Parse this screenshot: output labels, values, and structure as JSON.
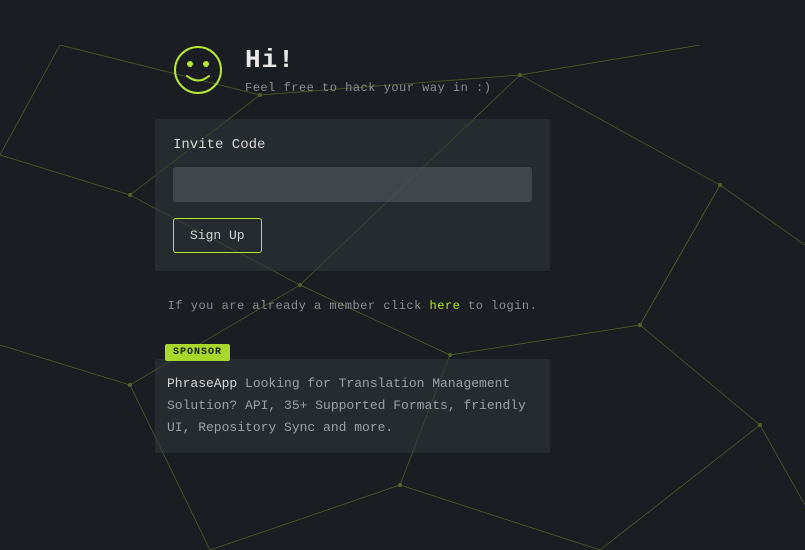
{
  "header": {
    "greeting": "Hi!",
    "subtitle": "Feel free to hack your way in :)"
  },
  "form": {
    "field_label": "Invite Code",
    "input_value": "",
    "input_placeholder": "",
    "submit_label": "Sign Up"
  },
  "login": {
    "prefix": "If you are already a member click ",
    "link_text": "here",
    "suffix": " to login."
  },
  "sponsor": {
    "badge": "SPONSOR",
    "name": "PhraseApp",
    "text": " Looking for Translation Management Solution? API, 35+ Supported Formats, friendly UI, Repository Sync and more."
  },
  "colors": {
    "accent": "#b8e635",
    "bg": "#1a1d21"
  },
  "icons": {
    "smiley": "smiley-icon"
  }
}
